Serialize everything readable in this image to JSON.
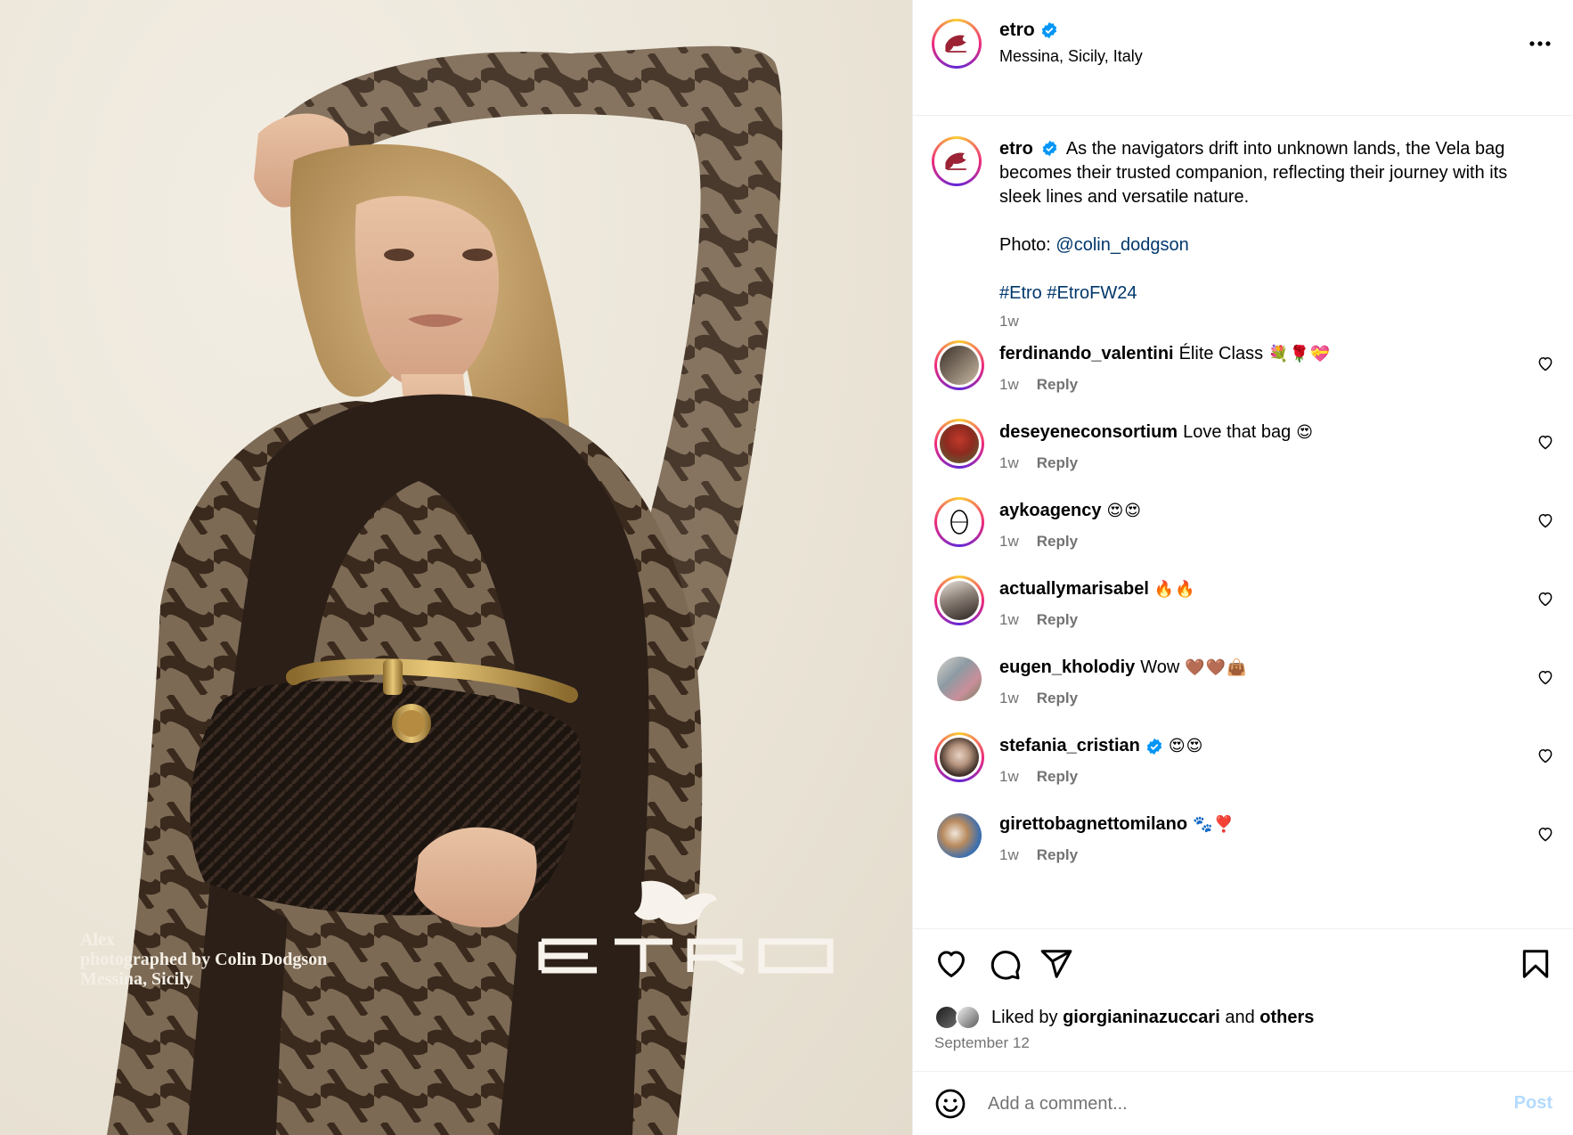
{
  "photo": {
    "credit_lines": [
      "Alex",
      "photographed by Colin Dodgson",
      "Messina, Sicily"
    ],
    "brand_wordmark": "ETRO"
  },
  "header": {
    "username": "etro",
    "location": "Messina, Sicily, Italy",
    "more_icon": "more-horizontal-icon"
  },
  "caption": {
    "username": "etro",
    "text": "As the navigators drift into unknown lands, the Vela bag becomes their trusted companion, reflecting their journey with its sleek lines and versatile nature.",
    "photo_label": "Photo:",
    "photo_mention": "@colin_dodgson",
    "hashtags": "#Etro #EtroFW24",
    "time": "1w"
  },
  "comments": [
    {
      "username": "ferdinando_valentini",
      "text": "Élite Class",
      "emoji": "💐🌹💝",
      "time": "1w",
      "reply": "Reply",
      "verified": false
    },
    {
      "username": "deseyeneconsortium",
      "text": "Love that bag",
      "emoji": "😍",
      "time": "1w",
      "reply": "Reply",
      "verified": false
    },
    {
      "username": "aykoagency",
      "text": "",
      "emoji": "😍😍",
      "time": "1w",
      "reply": "Reply",
      "verified": false
    },
    {
      "username": "actuallymarisabel",
      "text": "",
      "emoji": "🔥🔥",
      "time": "1w",
      "reply": "Reply",
      "verified": false
    },
    {
      "username": "eugen_kholodiy",
      "text": "Wow",
      "emoji": "🤎🤎👜",
      "time": "1w",
      "reply": "Reply",
      "verified": false
    },
    {
      "username": "stefania_cristian",
      "text": "",
      "emoji": "😍😍",
      "time": "1w",
      "reply": "Reply",
      "verified": true
    },
    {
      "username": "girettobagnettomilano",
      "text": "",
      "emoji": "🐾❣️",
      "time": "1w",
      "reply": "Reply",
      "verified": false
    }
  ],
  "actions": {
    "icons": [
      "heart-icon",
      "comment-icon",
      "share-icon",
      "bookmark-icon"
    ],
    "liked_prefix": "Liked by",
    "liked_user": "giorgianinazuccari",
    "liked_and": "and",
    "liked_others": "others",
    "date": "September 12"
  },
  "add_comment": {
    "placeholder": "Add a comment...",
    "post_label": "Post"
  },
  "colors": {
    "link": "#00376b",
    "muted": "#737373",
    "verified": "#0095f6",
    "post_disabled": "#b3dbff"
  }
}
